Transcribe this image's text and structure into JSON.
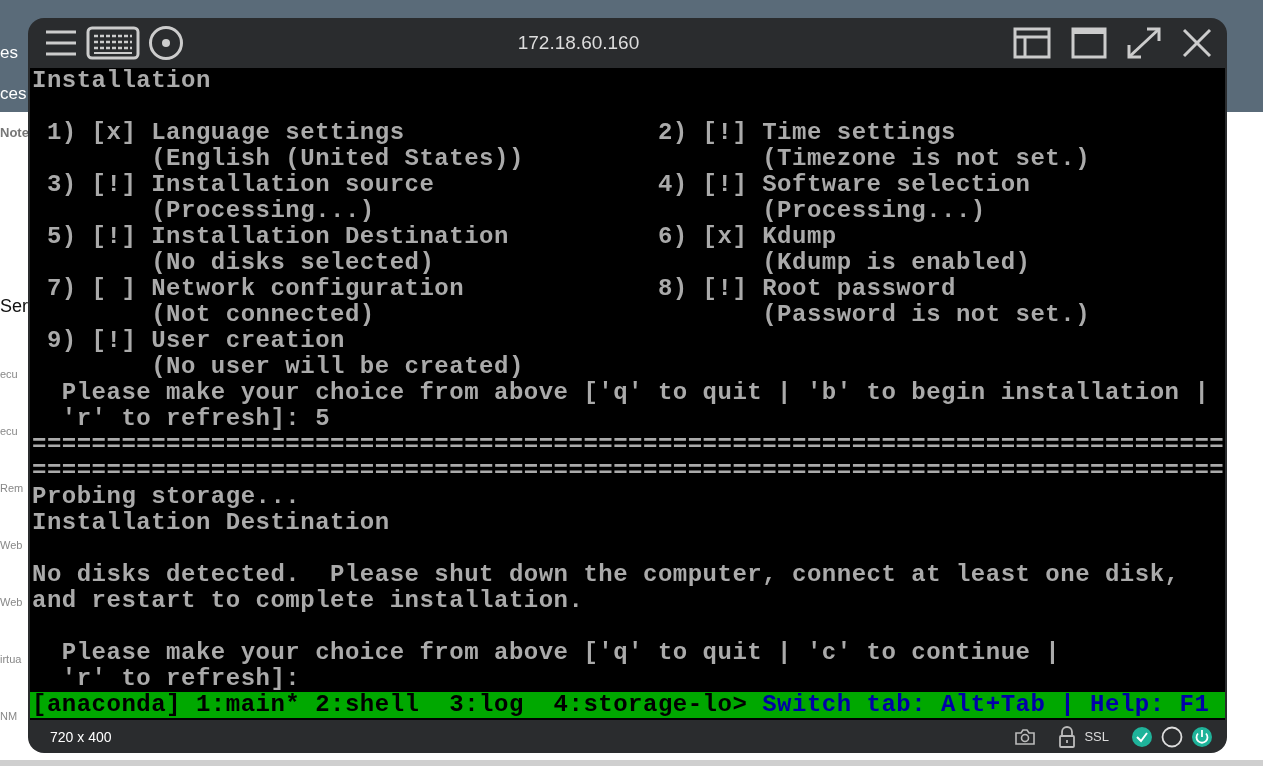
{
  "background": {
    "fragments": [
      {
        "text": "es",
        "kind": "heading"
      },
      {
        "text": "ces",
        "kind": "heading"
      },
      {
        "text": "Note",
        "kind": "label"
      },
      {
        "text": "Ser",
        "kind": "title"
      },
      {
        "text": "ecu",
        "kind": "item"
      },
      {
        "text": "ecu",
        "kind": "item"
      },
      {
        "text": "Rem",
        "kind": "item"
      },
      {
        "text": "Web",
        "kind": "item"
      },
      {
        "text": "Web",
        "kind": "item"
      },
      {
        "text": "irtua",
        "kind": "item"
      },
      {
        "text": "NM",
        "kind": "item"
      }
    ]
  },
  "window": {
    "title": "172.18.60.160",
    "footer": {
      "resolution": "720 x 400",
      "security": "SSL"
    }
  },
  "terminal": {
    "blocks": [
      {
        "lines": [
          "Installation"
        ]
      },
      {
        "lines": [
          " 1) [x] Language settings                 2) [!] Time settings",
          "        (English (United States))                (Timezone is not set.)",
          " 3) [!] Installation source               4) [!] Software selection",
          "        (Processing...)                          (Processing...)",
          " 5) [!] Installation Destination          6) [x] Kdump",
          "        (No disks selected)                      (Kdump is enabled)",
          " 7) [ ] Network configuration             8) [!] Root password",
          "        (Not connected)                          (Password is not set.)",
          " 9) [!] User creation",
          "        (No user will be created)",
          "  Please make your choice from above ['q' to quit | 'b' to begin installation |",
          "  'r' to refresh]: 5",
          "================================================================================",
          "================================================================================",
          "Probing storage...",
          "Installation Destination"
        ]
      },
      {
        "lines": [
          "No disks detected.  Please shut down the computer, connect at least one disk,",
          "and restart to complete installation."
        ]
      },
      {
        "lines": [
          "  Please make your choice from above ['q' to quit | 'c' to continue |",
          "  'r' to refresh]:"
        ]
      }
    ],
    "status_bar": {
      "tabs": "[anaconda] 1:main* 2:shell  3:log  4:storage-lo>",
      "help": "Switch tab: Alt+Tab | Help: F1"
    }
  }
}
